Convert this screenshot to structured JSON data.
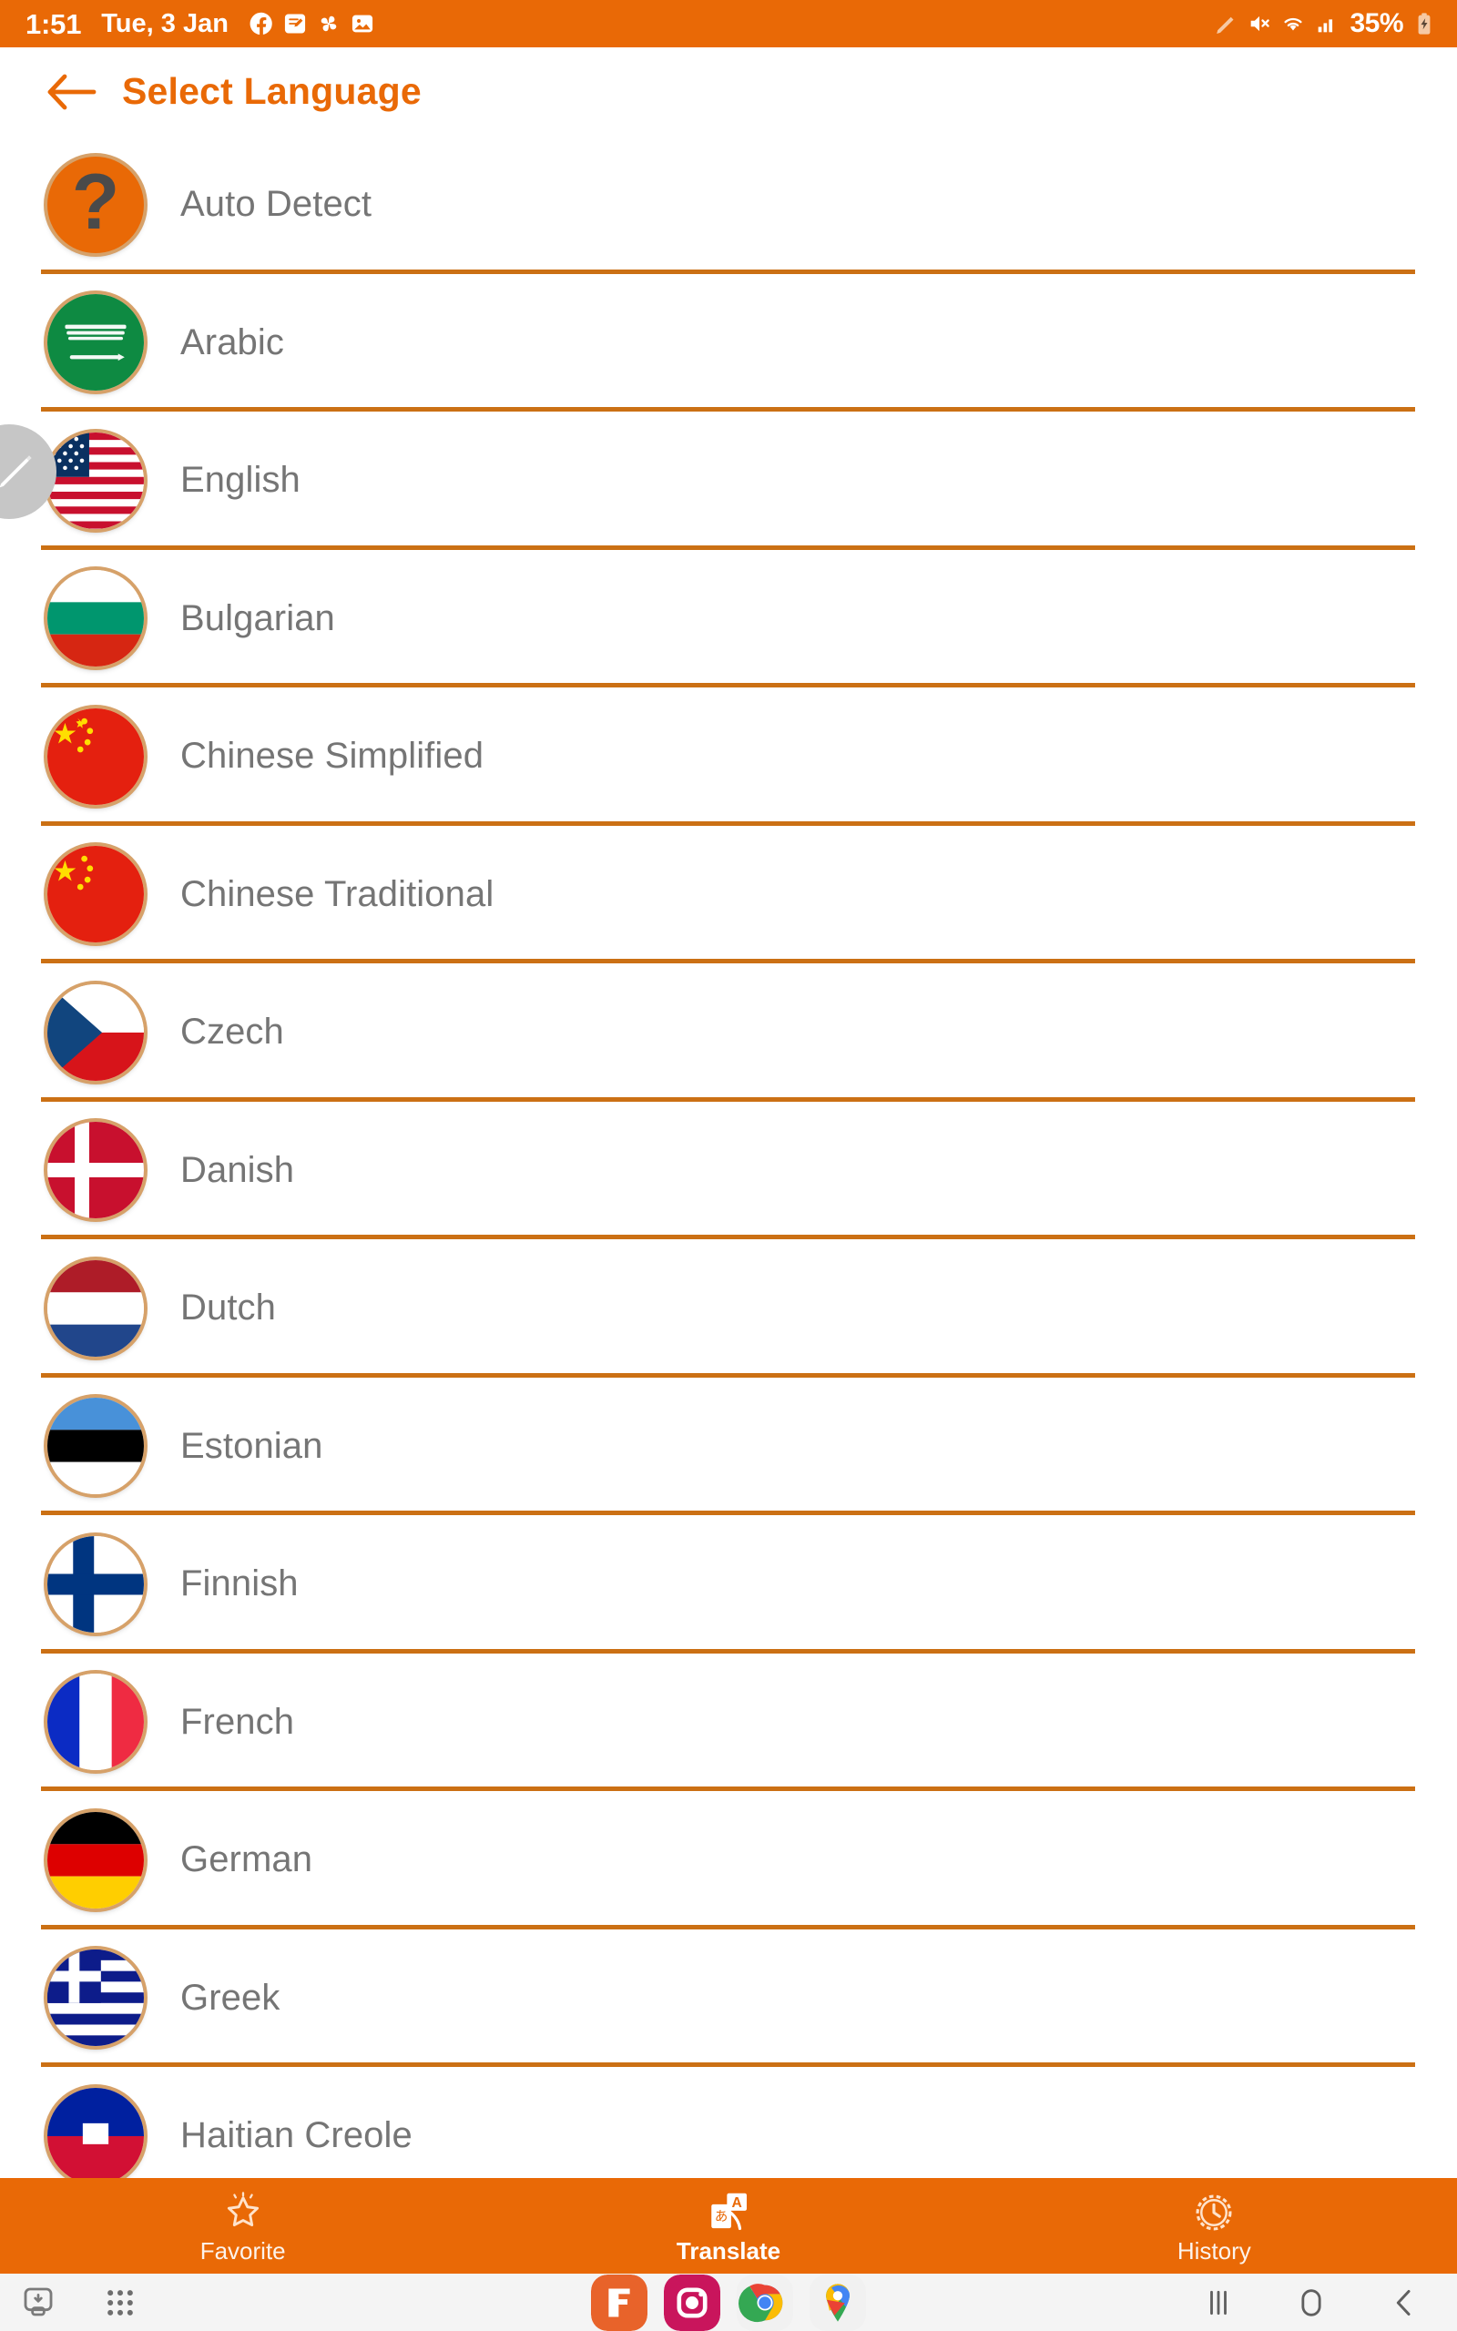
{
  "status_bar": {
    "time": "1:51",
    "date": "Tue, 3 Jan",
    "battery_percent": "35%",
    "notification_icons": [
      "facebook-icon",
      "samsung-notes-icon",
      "pinwheel-icon",
      "gallery-icon"
    ],
    "right_icons": [
      "pencil-icon",
      "mute-icon",
      "wifi-icon",
      "signal-icon",
      "battery-charging-icon"
    ],
    "background_color": "#E96906",
    "foreground_color": "#FFFFFF"
  },
  "app_bar": {
    "back_icon": "back-arrow-icon",
    "title": "Select Language",
    "title_color": "#E96906"
  },
  "edit_fab": {
    "icon": "pencil-icon",
    "color": "#C6C6C6"
  },
  "language_list": {
    "divider_color": "#CB7014",
    "label_color": "#757575",
    "items": [
      {
        "label": "Auto Detect",
        "flag": "auto-detect-question-icon"
      },
      {
        "label": "Arabic",
        "flag": "flag-saudi-arabia"
      },
      {
        "label": "English",
        "flag": "flag-united-states"
      },
      {
        "label": "Bulgarian",
        "flag": "flag-bulgaria"
      },
      {
        "label": "Chinese Simplified",
        "flag": "flag-china"
      },
      {
        "label": "Chinese Traditional",
        "flag": "flag-china"
      },
      {
        "label": "Czech",
        "flag": "flag-czech-republic"
      },
      {
        "label": "Danish",
        "flag": "flag-denmark"
      },
      {
        "label": "Dutch",
        "flag": "flag-netherlands"
      },
      {
        "label": "Estonian",
        "flag": "flag-estonia"
      },
      {
        "label": "Finnish",
        "flag": "flag-finland"
      },
      {
        "label": "French",
        "flag": "flag-france"
      },
      {
        "label": "German",
        "flag": "flag-germany"
      },
      {
        "label": "Greek",
        "flag": "flag-greece"
      },
      {
        "label": "Haitian Creole",
        "flag": "flag-haiti"
      }
    ]
  },
  "tab_bar": {
    "background_color": "#E96906",
    "tabs": [
      {
        "label": "Favorite",
        "icon": "star-icon",
        "active": false
      },
      {
        "label": "Translate",
        "icon": "translate-icon",
        "active": true
      },
      {
        "label": "History",
        "icon": "clock-icon",
        "active": false
      }
    ]
  },
  "system_nav": {
    "left_icons": [
      "screenshot-capture-icon",
      "apps-grid-icon"
    ],
    "dock_apps": [
      "samsung-notes-app-icon",
      "instagram-app-icon",
      "chrome-app-icon",
      "maps-app-icon"
    ],
    "right_icons": [
      "recents-icon",
      "home-icon",
      "back-icon"
    ]
  }
}
